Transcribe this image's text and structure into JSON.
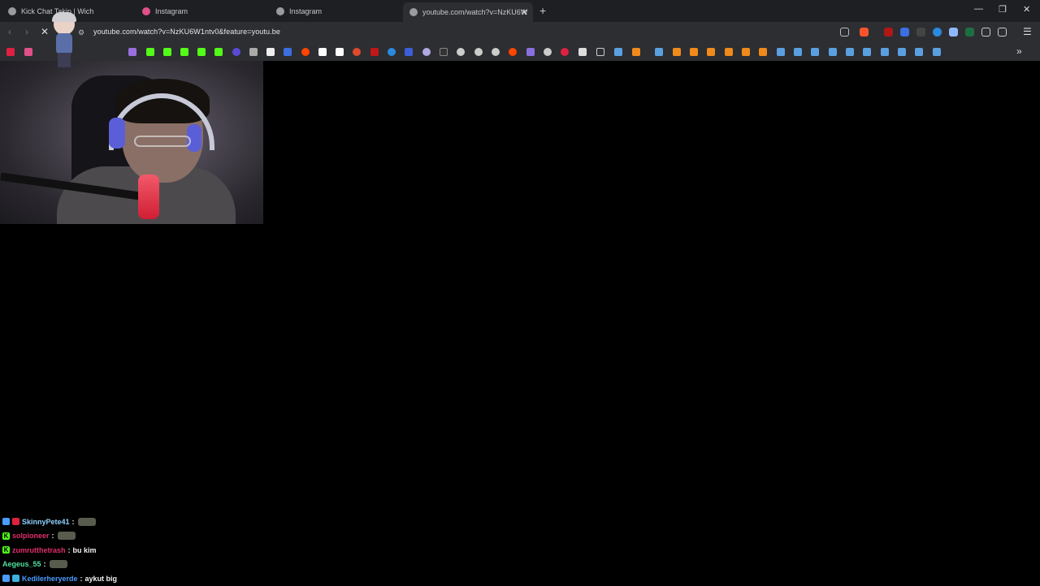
{
  "tabs": [
    {
      "title": "Kick Chat Takip | Wich"
    },
    {
      "title": "Instagram"
    },
    {
      "title": "Instagram"
    },
    {
      "title": "youtube.com/watch?v=NzKU6W"
    }
  ],
  "address_bar": {
    "url": "youtube.com/watch?v=NzKU6W1ntv0&feature=youtu.be"
  },
  "colors": {
    "accent_green": "#53fc18",
    "brand": "#ff3b3b"
  },
  "chat": {
    "messages": [
      {
        "user": "SkinnyPete41",
        "user_color": "#8fd3ff",
        "text": "",
        "emote": true
      },
      {
        "user": "solpioneer",
        "user_color": "#e0306a",
        "text": "",
        "emote": true
      },
      {
        "user": "zumrutthetrash",
        "user_color": "#e0306a",
        "text": "bu kim",
        "emote": false
      },
      {
        "user": "Aegeus_55",
        "user_color": "#4fe0a0",
        "text": "",
        "emote": true
      },
      {
        "user": "Kedilerheryerde",
        "user_color": "#4a9cff",
        "text": "aykut big",
        "emote": false
      }
    ]
  }
}
